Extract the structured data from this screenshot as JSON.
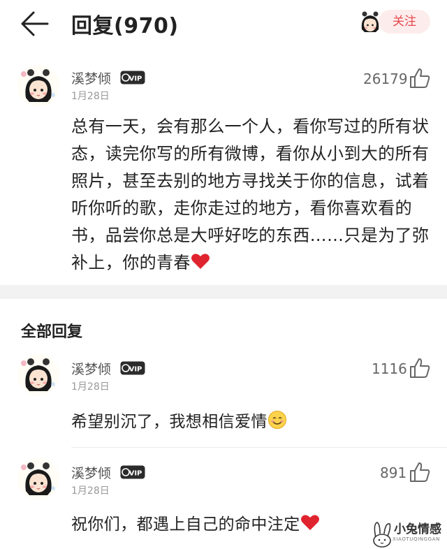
{
  "header": {
    "title": "回复(970)",
    "follow_label": "关注"
  },
  "main_comment": {
    "username": "溪梦倾",
    "badge": "VIP",
    "date": "1月28日",
    "likes": "26179",
    "text": "总有一天，会有那么一个人，看你写过的所有状态，读完你写的所有微博，看你从小到大的所有照片，甚至去别的地方寻找关于你的信息，试着听你听的歌，走你走过的地方，看你喜欢看的书，品尝你总是大呼好吃的东西……只是为了弥补上，你的青春"
  },
  "section": {
    "title": "全部回复"
  },
  "replies": [
    {
      "username": "溪梦倾",
      "badge": "VIP",
      "date": "1月28日",
      "likes": "1116",
      "text": "希望别沉了，我想相信爱情",
      "emoji": "smiling-face-icon"
    },
    {
      "username": "溪梦倾",
      "badge": "VIP",
      "date": "1月28日",
      "likes": "891",
      "text": "祝你们，都遇上自己的命中注定",
      "emoji": "red-heart-icon"
    }
  ],
  "watermark": {
    "name": "小兔情感",
    "sub": "XIAOTUQINGGAN"
  },
  "colors": {
    "accent": "#e5484d",
    "follow_bg": "#fdecec",
    "separator": "#f2f2f2"
  }
}
